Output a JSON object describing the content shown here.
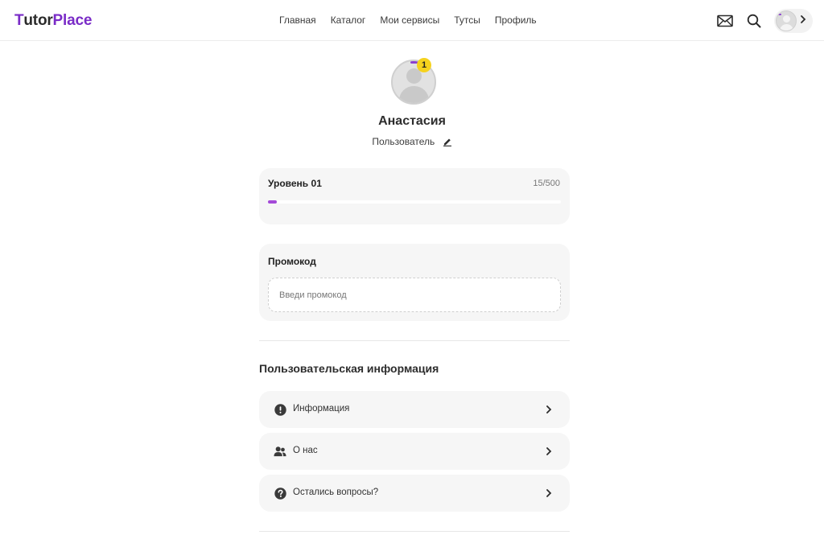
{
  "header": {
    "logo_first": "T",
    "logo_mid": "utor",
    "logo_last": "Place",
    "nav": [
      "Главная",
      "Каталог",
      "Мои сервисы",
      "Тутсы",
      "Профиль"
    ],
    "icons": [
      "mail-icon",
      "search-icon",
      "avatar",
      "chevron-right-icon"
    ]
  },
  "profile": {
    "badge": "1",
    "name": "Анастасия",
    "role": "Пользователь"
  },
  "level": {
    "title": "Уровень 01",
    "count": "15/500",
    "progress": 0.03
  },
  "promo": {
    "title": "Промокод",
    "placeholder": "Введи промокод"
  },
  "user_info": {
    "title": "Пользовательская информация",
    "items": [
      {
        "label": "Информация",
        "icon": "exclamation-circle-icon"
      },
      {
        "label": "О нас",
        "icon": "users-icon"
      },
      {
        "label": "Остались вопросы?",
        "icon": "question-circle-icon"
      }
    ]
  },
  "colors": {
    "accent": "#7a2cc7",
    "progress": "#a44ad8",
    "badge": "#f5d21e",
    "card": "#f6f6f6"
  }
}
